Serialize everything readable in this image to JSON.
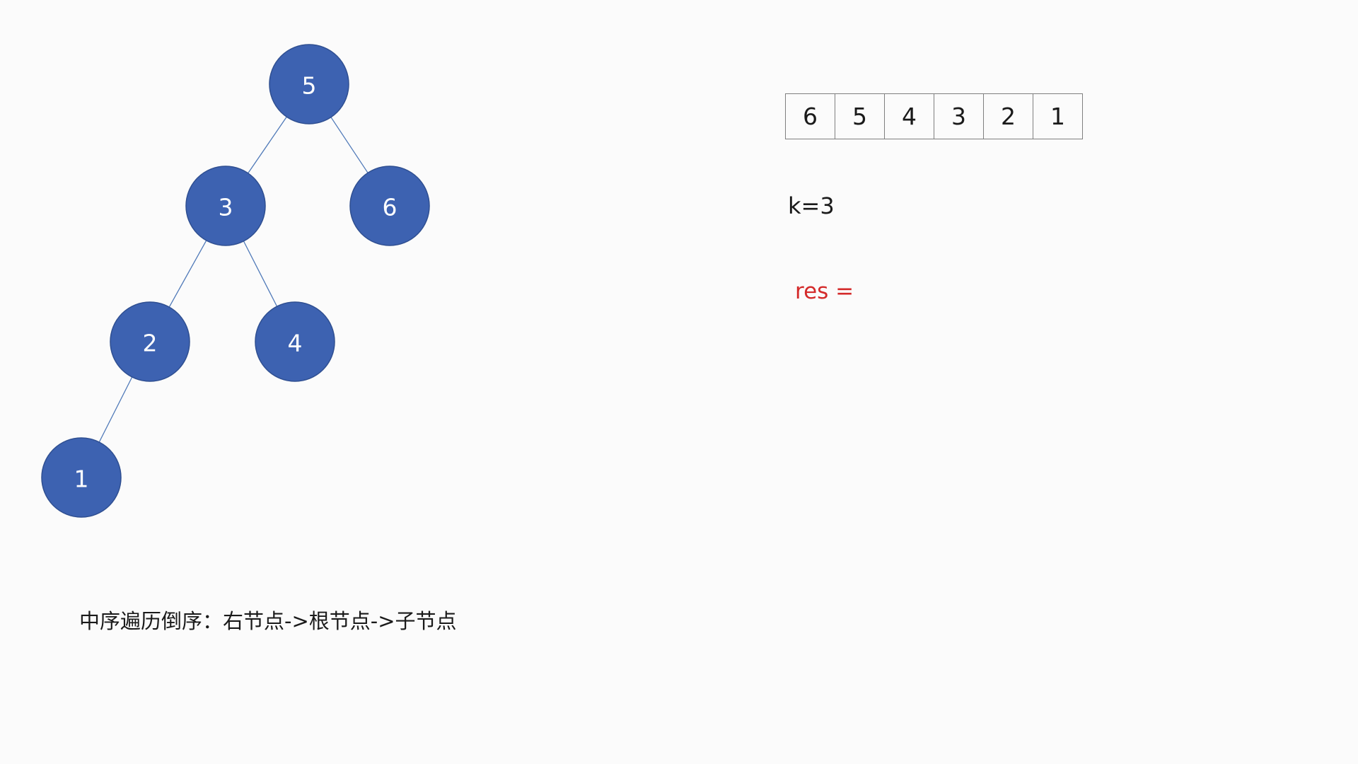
{
  "tree": {
    "nodes": [
      {
        "id": "n5",
        "label": "5"
      },
      {
        "id": "n3",
        "label": "3"
      },
      {
        "id": "n6",
        "label": "6"
      },
      {
        "id": "n2",
        "label": "2"
      },
      {
        "id": "n4",
        "label": "4"
      },
      {
        "id": "n1",
        "label": "1"
      }
    ],
    "edges": [
      {
        "from": "n5",
        "to": "n3"
      },
      {
        "from": "n5",
        "to": "n6"
      },
      {
        "from": "n3",
        "to": "n2"
      },
      {
        "from": "n3",
        "to": "n4"
      },
      {
        "from": "n2",
        "to": "n1"
      }
    ],
    "node_color": "#3d62b1",
    "edge_color": "#4f79b8"
  },
  "array": {
    "cells": [
      "6",
      "5",
      "4",
      "3",
      "2",
      "1"
    ]
  },
  "k_text": "k=3",
  "res_text": "res =",
  "res_color": "#d42a2a",
  "caption": "中序遍历倒序：右节点->根节点->子节点"
}
